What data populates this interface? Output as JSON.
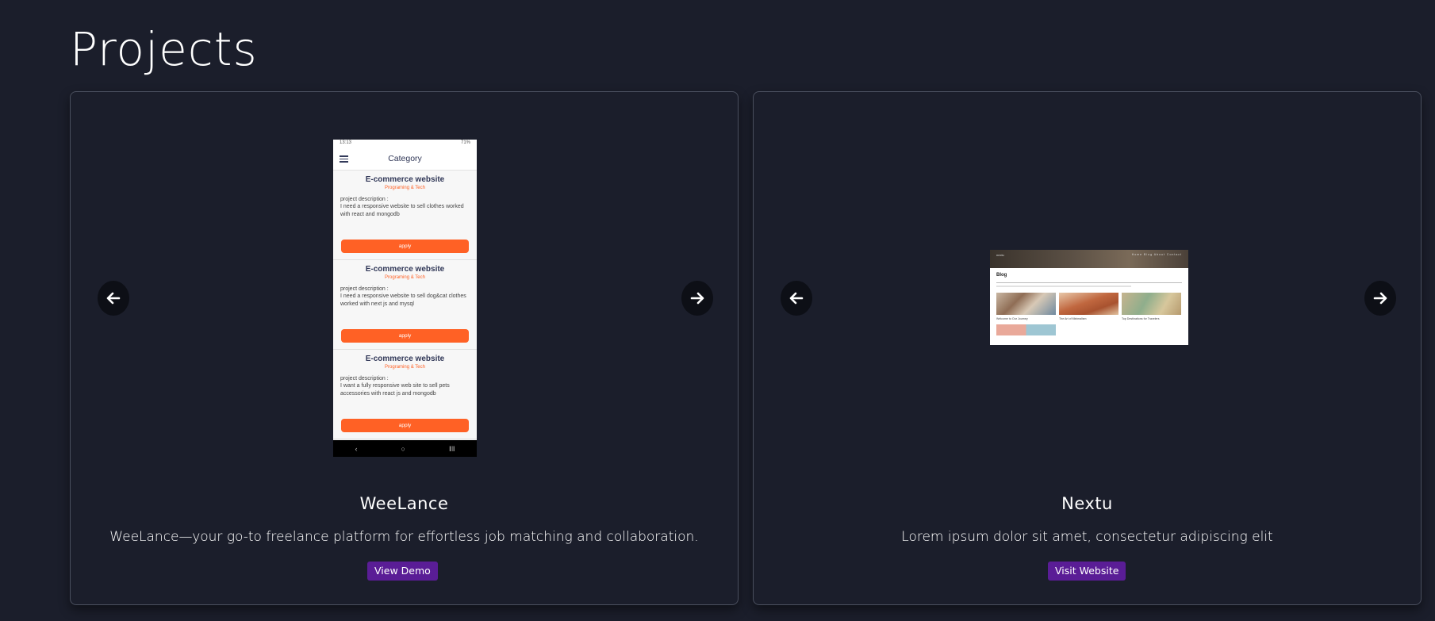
{
  "section": {
    "title": "Projects"
  },
  "colors": {
    "background": "#1b1e2b",
    "card_border": "#4a4f5e",
    "button": "#5a1d96",
    "accent_orange": "#ff6125"
  },
  "icons": {
    "prev": "arrow-left-icon",
    "next": "arrow-right-icon"
  },
  "projects": [
    {
      "title": "WeeLance",
      "description": "WeeLance—your go-to freelance platform for effortless job matching and collaboration.",
      "button_label": "View Demo",
      "screenshot": {
        "status_time": "13:13",
        "status_right": "71%",
        "app_title": "Category",
        "items": [
          {
            "title": "E-commerce website",
            "category": "Programing & Tech",
            "label": "project description :",
            "text": "I need a responsive website to sell clothes worked with react and mongodb",
            "apply": "apply"
          },
          {
            "title": "E-commerce website",
            "category": "Programing & Tech",
            "label": "project description :",
            "text": "I need a responsive website to sell dog&cat clothes worked with next js and mysql",
            "apply": "apply"
          },
          {
            "title": "E-commerce website",
            "category": "Programing & Tech",
            "label": "project description :",
            "text": "I want a fully responsive web site to sell pets accessories with react js and mongodb",
            "apply": "apply"
          }
        ]
      }
    },
    {
      "title": "Nextu",
      "description": "Lorem ipsum dolor sit amet, consectetur adipiscing elit",
      "button_label": "Visit Website",
      "screenshot": {
        "brand": "nextu",
        "nav_links": "Home  Blog  About  Contact",
        "page_title": "Blog",
        "posts": [
          "Welcome to Our Journey",
          "The Art of Minimalism",
          "Top Destinations for Travelers"
        ]
      }
    }
  ]
}
